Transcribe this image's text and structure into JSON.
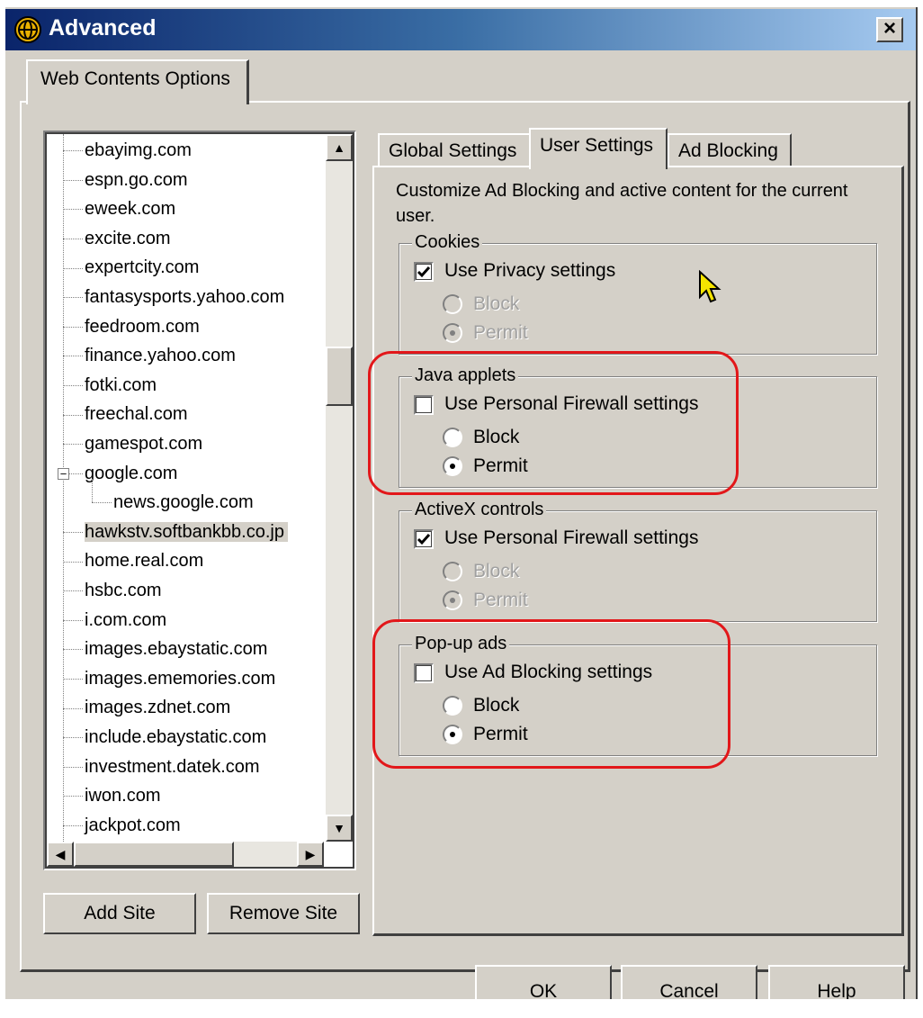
{
  "window": {
    "title": "Advanced",
    "close_label": "×"
  },
  "outer_tab": {
    "label": "Web Contents Options"
  },
  "site_tree": {
    "items": [
      {
        "label": "ebayimg.com",
        "level": 0
      },
      {
        "label": "espn.go.com",
        "level": 0
      },
      {
        "label": "eweek.com",
        "level": 0
      },
      {
        "label": "excite.com",
        "level": 0
      },
      {
        "label": "expertcity.com",
        "level": 0
      },
      {
        "label": "fantasysports.yahoo.com",
        "level": 0
      },
      {
        "label": "feedroom.com",
        "level": 0
      },
      {
        "label": "finance.yahoo.com",
        "level": 0
      },
      {
        "label": "fotki.com",
        "level": 0
      },
      {
        "label": "freechal.com",
        "level": 0
      },
      {
        "label": "gamespot.com",
        "level": 0
      },
      {
        "label": "google.com",
        "level": 0,
        "expanded": true
      },
      {
        "label": "news.google.com",
        "level": 1
      },
      {
        "label": "hawkstv.softbankbb.co.jp",
        "level": 0,
        "selected": true
      },
      {
        "label": "home.real.com",
        "level": 0
      },
      {
        "label": "hsbc.com",
        "level": 0
      },
      {
        "label": "i.com.com",
        "level": 0
      },
      {
        "label": "images.ebaystatic.com",
        "level": 0
      },
      {
        "label": "images.ememories.com",
        "level": 0
      },
      {
        "label": "images.zdnet.com",
        "level": 0
      },
      {
        "label": "include.ebaystatic.com",
        "level": 0
      },
      {
        "label": "investment.datek.com",
        "level": 0
      },
      {
        "label": "iwon.com",
        "level": 0
      },
      {
        "label": "jackpot.com",
        "level": 0
      }
    ]
  },
  "buttons": {
    "add_site": "Add Site",
    "remove_site": "Remove Site"
  },
  "inner_tabs": {
    "global": "Global Settings",
    "user": "User Settings",
    "ad_blocking": "Ad Blocking",
    "active": "User Settings"
  },
  "description": "Customize Ad Blocking and active content for the current user.",
  "groups": {
    "cookies": {
      "title": "Cookies",
      "checkbox_label": "Use Privacy settings",
      "checked": true,
      "block": "Block",
      "permit": "Permit",
      "selected": "Permit",
      "disabled": true
    },
    "java": {
      "title": "Java applets",
      "checkbox_label": "Use Personal Firewall settings",
      "checked": false,
      "block": "Block",
      "permit": "Permit",
      "selected": "Permit",
      "disabled": false
    },
    "activex": {
      "title": "ActiveX controls",
      "checkbox_label": "Use Personal Firewall settings",
      "checked": true,
      "block": "Block",
      "permit": "Permit",
      "selected": "Permit",
      "disabled": true
    },
    "popup": {
      "title": "Pop-up ads",
      "checkbox_label": "Use Ad Blocking settings",
      "checked": false,
      "block": "Block",
      "permit": "Permit",
      "selected": "Permit",
      "disabled": false
    }
  },
  "dialog_buttons": {
    "ok": "OK",
    "cancel": "Cancel",
    "help": "Help"
  },
  "colors": {
    "highlight": "#e2171a",
    "face": "#d4d0c8",
    "title_start": "#0a246a"
  }
}
